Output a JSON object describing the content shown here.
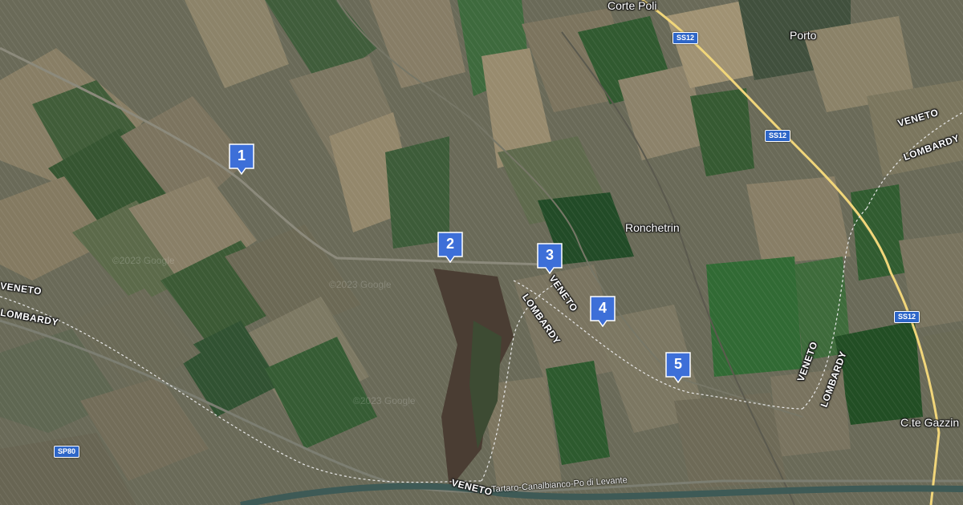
{
  "places": [
    {
      "id": "corte-poli",
      "name": "Corte Poli"
    },
    {
      "id": "porto",
      "name": "Porto"
    },
    {
      "id": "ronchetrin",
      "name": "Ronchetrin"
    },
    {
      "id": "c-te-gazzin",
      "name": "C.te Gazzin"
    }
  ],
  "regions": [
    {
      "id": "veneto-top-right",
      "name": "VENETO"
    },
    {
      "id": "lombardy-top-right",
      "name": "LOMBARDY"
    },
    {
      "id": "veneto-left",
      "name": "VENETO"
    },
    {
      "id": "lombardy-left",
      "name": "LOMBARDY"
    },
    {
      "id": "veneto-center",
      "name": "VENETO"
    },
    {
      "id": "lombardy-center",
      "name": "LOMBARDY"
    },
    {
      "id": "veneto-right",
      "name": "VENETO"
    },
    {
      "id": "lombardy-right",
      "name": "LOMBARDY"
    },
    {
      "id": "veneto-bottom",
      "name": "VENETO"
    }
  ],
  "road_shields": [
    {
      "id": "ss12-top",
      "label": "SS12"
    },
    {
      "id": "ss12-mid",
      "label": "SS12"
    },
    {
      "id": "ss12-lower",
      "label": "SS12"
    },
    {
      "id": "sp80",
      "label": "SP80"
    }
  ],
  "canal": {
    "name": "Tartaro-Canalbianco-Po di Levante"
  },
  "watermarks": [
    "©2023 Google",
    "©2023 Google",
    "©2023 Google"
  ],
  "markers": [
    {
      "label": "1"
    },
    {
      "label": "2"
    },
    {
      "label": "3"
    },
    {
      "label": "4"
    },
    {
      "label": "5"
    }
  ],
  "colors": {
    "marker_fill": "#3d6fd8",
    "marker_border": "#ffffff",
    "highway": "#f1d67a",
    "boundary": "#e8e8e8",
    "canal": "#3e5a56"
  }
}
